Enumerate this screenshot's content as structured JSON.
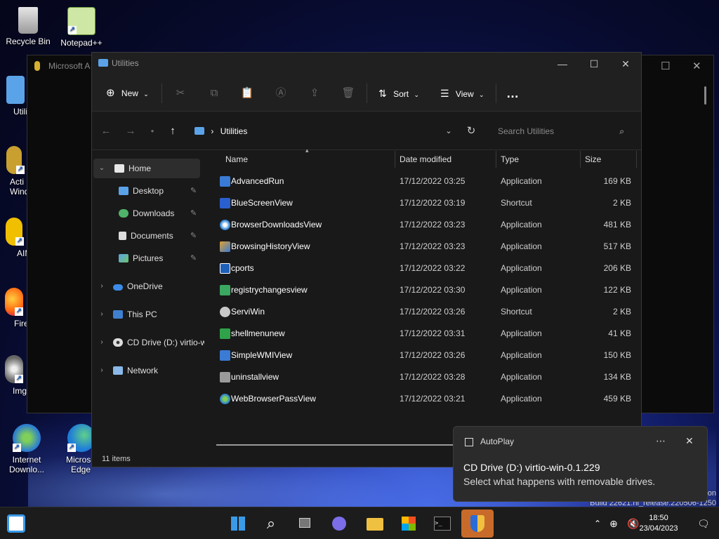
{
  "desktop": {
    "icons": [
      {
        "label": "Recycle Bin"
      },
      {
        "label": "Notepad++"
      },
      {
        "label": "Utili"
      },
      {
        "label": "Acti Wind"
      },
      {
        "label": "AIM"
      },
      {
        "label": "Fire"
      },
      {
        "label": "ImgI"
      },
      {
        "label": "Internet Downlo..."
      },
      {
        "label": "Microso Edge"
      }
    ]
  },
  "bg_window": {
    "title": "Microsoft A"
  },
  "explorer": {
    "title": "Utilities",
    "toolbar": {
      "new_label": "New",
      "sort_label": "Sort",
      "view_label": "View",
      "more_label": "…"
    },
    "address": {
      "path_sep": "›",
      "current": "Utilities",
      "search_placeholder": "Search Utilities"
    },
    "nav": {
      "home": "Home",
      "quick": [
        "Desktop",
        "Downloads",
        "Documents",
        "Pictures"
      ],
      "onedrive": "OneDrive",
      "thispc": "This PC",
      "cddrive": "CD Drive (D:) virtio-w",
      "network": "Network"
    },
    "columns": {
      "name": "Name",
      "date": "Date modified",
      "type": "Type",
      "size": "Size"
    },
    "files": [
      {
        "name": "AdvancedRun",
        "date": "17/12/2022 03:25",
        "type": "Application",
        "size": "169 KB"
      },
      {
        "name": "BlueScreenView",
        "date": "17/12/2022 03:19",
        "type": "Shortcut",
        "size": "2 KB"
      },
      {
        "name": "BrowserDownloadsView",
        "date": "17/12/2022 03:23",
        "type": "Application",
        "size": "481 KB"
      },
      {
        "name": "BrowsingHistoryView",
        "date": "17/12/2022 03:23",
        "type": "Application",
        "size": "517 KB"
      },
      {
        "name": "cports",
        "date": "17/12/2022 03:22",
        "type": "Application",
        "size": "206 KB"
      },
      {
        "name": "registrychangesview",
        "date": "17/12/2022 03:30",
        "type": "Application",
        "size": "122 KB"
      },
      {
        "name": "ServiWin",
        "date": "17/12/2022 03:26",
        "type": "Shortcut",
        "size": "2 KB"
      },
      {
        "name": "shellmenunew",
        "date": "17/12/2022 03:31",
        "type": "Application",
        "size": "41 KB"
      },
      {
        "name": "SimpleWMIView",
        "date": "17/12/2022 03:26",
        "type": "Application",
        "size": "150 KB"
      },
      {
        "name": "uninstallview",
        "date": "17/12/2022 03:28",
        "type": "Application",
        "size": "134 KB"
      },
      {
        "name": "WebBrowserPassView",
        "date": "17/12/2022 03:21",
        "type": "Application",
        "size": "459 KB"
      }
    ],
    "status": "11 items"
  },
  "toast": {
    "app": "AutoPlay",
    "line1": "CD Drive (D:) virtio-win-0.1.229",
    "line2": "Select what happens with removable drives."
  },
  "watermark": {
    "line1": "on",
    "line2": "Build 22621.ni_release.220506-1250"
  },
  "clock": {
    "time": "18:50",
    "date": "23/04/2023"
  },
  "colors": {
    "accent": "#5ba3e8",
    "taskbar_active": "#c86a2a"
  }
}
